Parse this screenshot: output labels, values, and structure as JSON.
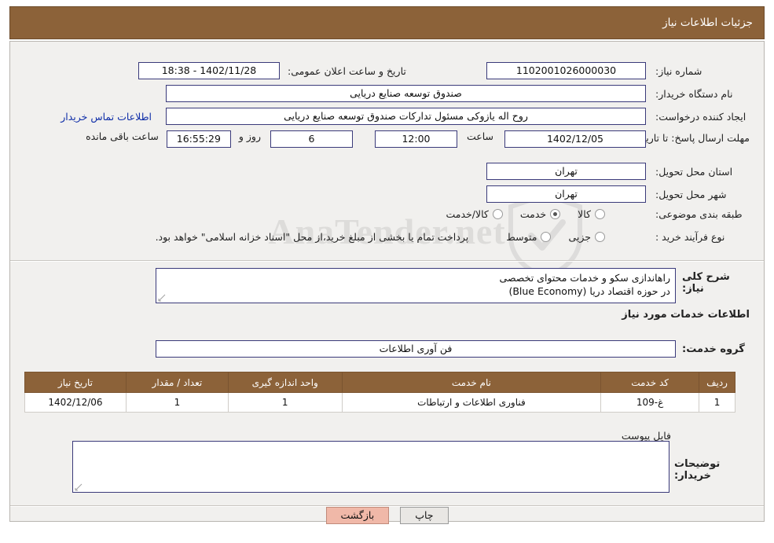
{
  "header": {
    "title": "جزئیات اطلاعات نیاز"
  },
  "watermark": {
    "text": "AnaTender.net"
  },
  "form": {
    "need_number": {
      "label": "شماره نیاز:",
      "value": "1102001026000030"
    },
    "public_announce": {
      "label": "تاریخ و ساعت اعلان عمومی:",
      "value": "1402/11/28 - 18:38"
    },
    "buyer_org": {
      "label": "نام دستگاه خریدار:",
      "value": "صندوق توسعه صنایع دریایی"
    },
    "requester": {
      "label": "ایجاد کننده درخواست:",
      "value": "روح اله یازوکی مسئول تدارکات صندوق توسعه صنایع دریایی"
    },
    "buyer_contact_link": "اطلاعات تماس خریدار",
    "deadline": {
      "label": "مهلت ارسال پاسخ: تا تاریخ:",
      "date": "1402/12/05",
      "time_label": "ساعت",
      "time": "12:00",
      "days": "6",
      "days_label": "روز و",
      "clock": "16:55:29",
      "remaining_label": "ساعت باقی مانده"
    },
    "province": {
      "label": "استان محل تحویل:",
      "value": "تهران"
    },
    "city": {
      "label": "شهر محل تحویل:",
      "value": "تهران"
    },
    "category": {
      "label": "طبقه بندی موضوعی:",
      "options": [
        "کالا",
        "خدمت",
        "کالا/خدمت"
      ],
      "selected_index": 1
    },
    "purchase_type": {
      "label": "نوع فرآیند خرید :",
      "options": [
        "جزیی",
        "متوسط"
      ],
      "selected_index": -1,
      "note": "پرداخت تمام یا بخشی از مبلغ خرید،از محل \"اسناد خزانه اسلامی\" خواهد بود."
    }
  },
  "description": {
    "label": "شرح کلی نیاز:",
    "lines": [
      "راهاندازی سکو و خدمات محتوای تخصصی",
      "در حوزه اقتصاد دریا (Blue Economy)"
    ]
  },
  "services": {
    "heading": "اطلاعات خدمات مورد نیاز",
    "group_label": "گروه خدمت:",
    "group_value": "فن آوری اطلاعات",
    "columns": [
      "ردیف",
      "کد خدمت",
      "نام خدمت",
      "واحد اندازه گیری",
      "تعداد / مقدار",
      "تاریخ نیاز"
    ],
    "rows": [
      {
        "row": "1",
        "code": "غ-109",
        "name": "فناوری اطلاعات و ارتباطات",
        "unit": "1",
        "qty": "1",
        "date": "1402/12/06"
      }
    ]
  },
  "buyer_notes": {
    "label": "توضیحات خریدار:",
    "attachment_label": "فایل پیوست",
    "value": ""
  },
  "buttons": {
    "print": "چاپ",
    "back": "بازگشت"
  },
  "colors": {
    "brand": "#8c6239",
    "link": "#0f2ea8",
    "field_border": "#3a3a7a",
    "back_btn": "#f0b8a8"
  }
}
